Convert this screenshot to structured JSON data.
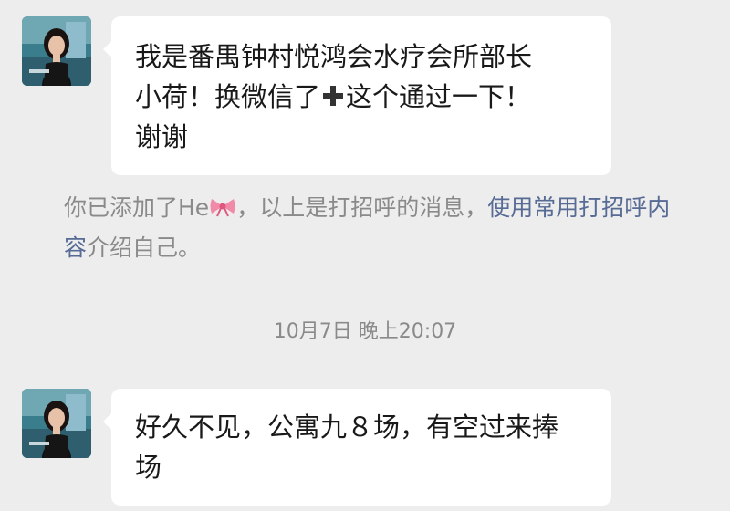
{
  "messages": [
    {
      "sender": "other",
      "avatar_icon": "profile-photo-woman",
      "text_line1": "我是番禺钟村悦鸿会水疗会所部长",
      "text_line2_a": "小荷！换微信了",
      "text_line2_b": "这个通过一下！",
      "text_line3": "谢谢",
      "inline_icon": "plus-icon"
    },
    {
      "sender": "other",
      "avatar_icon": "profile-photo-woman",
      "text_line1": "好久不见，公寓九８场，有空过来捧",
      "text_line2": "场"
    }
  ],
  "system_note": {
    "prefix": "你已添加了He",
    "middle": "，以上是打招呼的消息，",
    "link": "使用常用打招呼内容",
    "suffix": "介绍自己。",
    "inline_icon": "bow-emoji-icon"
  },
  "timestamp": "10月7日 晚上20:07",
  "colors": {
    "background": "#ededed",
    "bubble": "#ffffff",
    "system_text": "#8a8a8a",
    "link": "#576b95",
    "message_text": "#191919"
  }
}
